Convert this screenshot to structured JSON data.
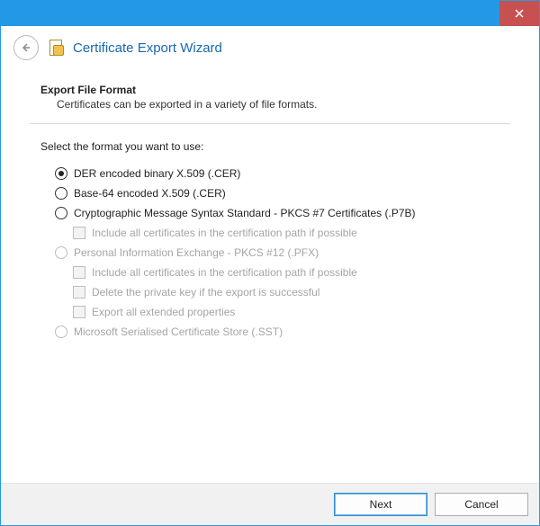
{
  "header": {
    "title": "Certificate Export Wizard"
  },
  "section": {
    "title": "Export File Format",
    "description": "Certificates can be exported in a variety of file formats."
  },
  "prompt": "Select the format you want to use:",
  "options": {
    "der": {
      "label": "DER encoded binary X.509 (.CER)",
      "selected": true,
      "enabled": true
    },
    "base64": {
      "label": "Base-64 encoded X.509 (.CER)",
      "selected": false,
      "enabled": true
    },
    "pkcs7": {
      "label": "Cryptographic Message Syntax Standard - PKCS #7 Certificates (.P7B)",
      "selected": false,
      "enabled": true,
      "include_chain": {
        "label": "Include all certificates in the certification path if possible",
        "checked": false,
        "enabled": false
      }
    },
    "pkcs12": {
      "label": "Personal Information Exchange - PKCS #12 (.PFX)",
      "selected": false,
      "enabled": false,
      "include_chain": {
        "label": "Include all certificates in the certification path if possible",
        "checked": false,
        "enabled": false
      },
      "delete_key": {
        "label": "Delete the private key if the export is successful",
        "checked": false,
        "enabled": false
      },
      "export_ext": {
        "label": "Export all extended properties",
        "checked": false,
        "enabled": false
      }
    },
    "sst": {
      "label": "Microsoft Serialised Certificate Store (.SST)",
      "selected": false,
      "enabled": false
    }
  },
  "buttons": {
    "next": "Next",
    "cancel": "Cancel"
  }
}
